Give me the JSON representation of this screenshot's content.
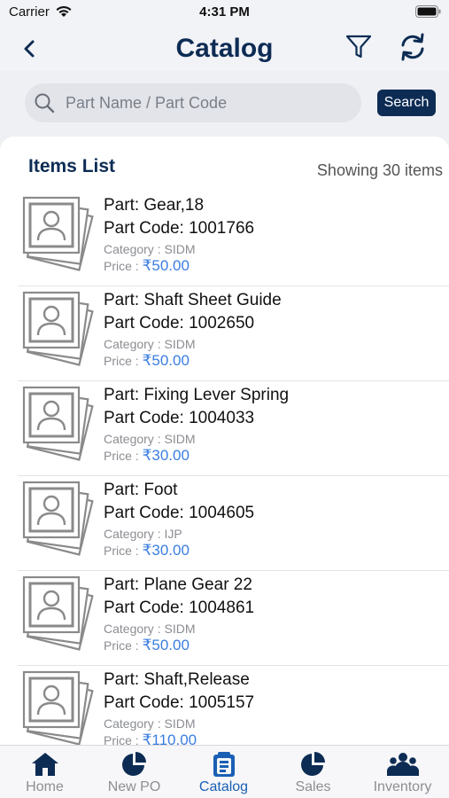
{
  "status_bar": {
    "carrier": "Carrier",
    "time": "4:31 PM"
  },
  "nav": {
    "title": "Catalog",
    "back_icon": "chevron-left-icon",
    "filter_icon": "filter-icon",
    "refresh_icon": "refresh-icon"
  },
  "search": {
    "placeholder": "Part Name / Part Code",
    "value": "",
    "button_label": "Search"
  },
  "list": {
    "title": "Items List",
    "count_text": "Showing 30 items",
    "price_label": "Price : ",
    "items": [
      {
        "name": "Part: Gear,18",
        "code": "Part Code: 1001766",
        "category": "Category : SIDM",
        "price": "₹50.00"
      },
      {
        "name": "Part: Shaft Sheet Guide",
        "code": "Part Code: 1002650",
        "category": "Category : SIDM",
        "price": "₹50.00"
      },
      {
        "name": "Part: Fixing Lever Spring",
        "code": "Part Code: 1004033",
        "category": "Category : SIDM",
        "price": "₹30.00"
      },
      {
        "name": "Part: Foot",
        "code": "Part Code: 1004605",
        "category": "Category : IJP",
        "price": "₹30.00"
      },
      {
        "name": "Part: Plane Gear 22",
        "code": "Part Code: 1004861",
        "category": "Category : SIDM",
        "price": "₹50.00"
      },
      {
        "name": "Part: Shaft,Release",
        "code": "Part Code: 1005157",
        "category": "Category : SIDM",
        "price": "₹110.00"
      }
    ]
  },
  "tabs": [
    {
      "label": "Home",
      "icon": "home-icon",
      "active": false
    },
    {
      "label": "New PO",
      "icon": "pie-chart-icon",
      "active": false
    },
    {
      "label": "Catalog",
      "icon": "catalog-icon",
      "active": true
    },
    {
      "label": "Sales",
      "icon": "pie-chart-icon",
      "active": false
    },
    {
      "label": "Inventory",
      "icon": "people-icon",
      "active": false
    }
  ],
  "colors": {
    "primary": "#0d2c54",
    "price": "#3a7de0",
    "active_tab": "#1a5fb4",
    "inactive_tab": "#8e8e93"
  }
}
